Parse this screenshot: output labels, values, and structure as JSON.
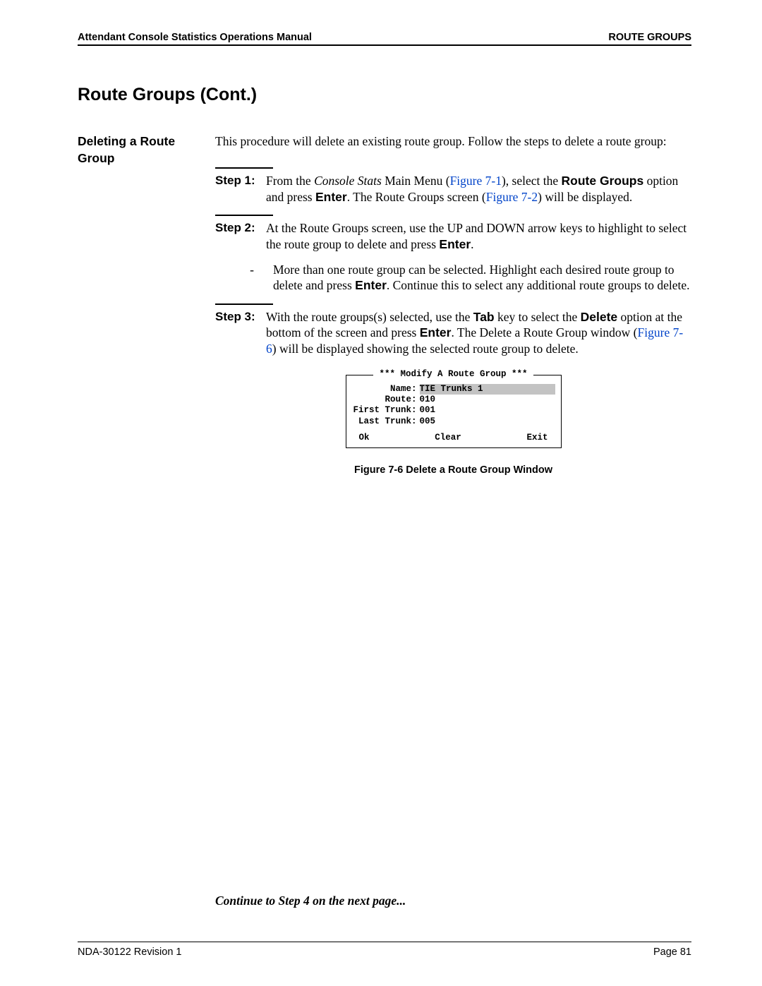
{
  "header": {
    "left": "Attendant Console Statistics Operations Manual",
    "right": "ROUTE GROUPS"
  },
  "section_title": "Route Groups (Cont.)",
  "subtitle": "Deleting a Route Group",
  "intro": "This procedure will delete an existing route group. Follow the steps to delete a route group:",
  "step1": {
    "label": "Step 1:",
    "t1": "From the ",
    "italic": "Console Stats",
    "t2": " Main Menu (",
    "link1": "Figure 7-1",
    "t3": "), select the ",
    "bold1": "Route Groups",
    "t4": " option and press ",
    "bold2": "Enter",
    "t5": ". The Route Groups screen (",
    "link2": "Figure 7-2",
    "t6": ") will be displayed."
  },
  "step2": {
    "label": "Step 2:",
    "t1": "At the Route Groups screen, use the UP and DOWN arrow keys to highlight to select the route group to delete and press ",
    "bold1": "Enter",
    "t2": ".",
    "bullet_dash": "-",
    "b_t1": "More than one route group can be selected. Highlight each desired route group to delete and press ",
    "b_bold1": "Enter",
    "b_t2": ". Continue this to select any additional route groups to delete."
  },
  "step3": {
    "label": "Step 3:",
    "t1": "With the route groups(s) selected, use the ",
    "bold1": "Tab",
    "t2": " key to select the ",
    "bold2": "Delete",
    "t3": " option at the bottom of the screen and press ",
    "bold3": "Enter",
    "t4": ". The Delete a Route Group window (",
    "link1": "Figure 7-6",
    "t5": ") will be displayed showing the selected route group to delete."
  },
  "terminal": {
    "title": "*** Modify A Route Group ***",
    "name_lbl": "Name:",
    "name_val": "TIE Trunks 1",
    "route_lbl": "Route:",
    "route_val": "010",
    "first_lbl": "First Trunk:",
    "first_val": "001",
    "last_lbl": "Last Trunk:",
    "last_val": "005",
    "ok": "Ok",
    "clear": "Clear",
    "exit": "Exit"
  },
  "figure_caption": "Figure 7-6   Delete a Route Group Window",
  "continue": "Continue to Step 4 on the next page...",
  "footer": {
    "left": "NDA-30122   Revision 1",
    "right": "Page 81"
  }
}
